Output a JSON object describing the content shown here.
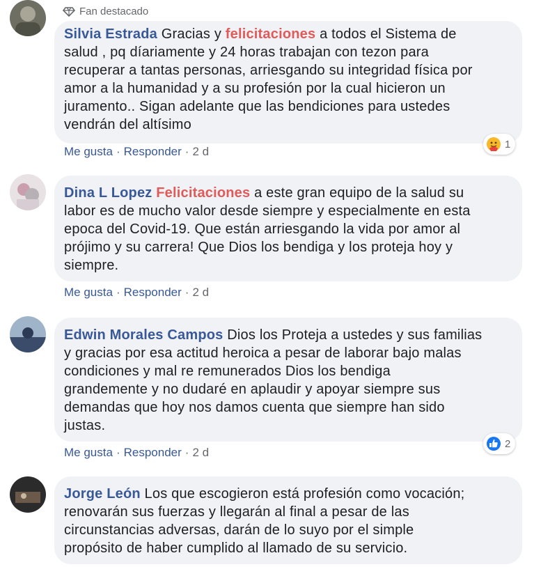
{
  "comments": [
    {
      "badge": "Fan destacado",
      "author": "Silvia Estrada",
      "text_before": "Gracias y ",
      "highlight": "felicitaciones",
      "text_after": " a todos el Sistema de\nsalud , pq díariamente y 24 horas trabajan con tezon para\nrecuperar a tantas personas, arriesgando su integridad física por\namor a la humanidad y a su profesión por la cual hicieron un\njuramento.. Sigan adelante que las bendiciones para ustedes\nvendrán del altísimo",
      "like": "Me gusta",
      "reply": "Responder",
      "time": "2 d",
      "reaction_icon": "care-reaction-icon",
      "reaction_count": "1"
    },
    {
      "author": "Dina L Lopez",
      "highlight": "Felicitaciones",
      "text_after": " a este gran equipo de la salud su\nlabor es de mucho valor desde siempre y especialmente en esta\nepoca del Covid-19. Que están arriesgando la vida por amor al\nprójimo y su carrera! Que Dios los bendiga y los proteja hoy y\nsiempre.",
      "like": "Me gusta",
      "reply": "Responder",
      "time": "2 d"
    },
    {
      "author": "Edwin Morales Campos",
      "text_after": " Dios los Proteja a ustedes y sus familias\ny gracias por esa actitud heroica a pesar de laborar bajo malas\ncondiciones y mal re remunerados Dios los bendiga\ngrandemente y no dudaré en aplaudir y apoyar siempre sus\ndemandas que hoy nos damos cuenta que siempre han sido\njustas.",
      "like": "Me gusta",
      "reply": "Responder",
      "time": "2 d",
      "reaction_icon": "like-reaction-icon",
      "reaction_count": "2"
    },
    {
      "author": "Jorge León",
      "text_after": " Los que escogieron está profesión como vocación;\nrenovarán sus fuerzas y llegarán al final a pesar de las\ncircunstancias adversas, darán de lo suyo por el simple\npropósito de haber cumplido al llamado de su servicio."
    }
  ],
  "separator": "·",
  "colors": {
    "author": "#385898",
    "highlight": "#e05a5a",
    "bubble": "#f0f2f5",
    "like_reaction": "#1877f2",
    "care_reaction": "#f7b928"
  }
}
